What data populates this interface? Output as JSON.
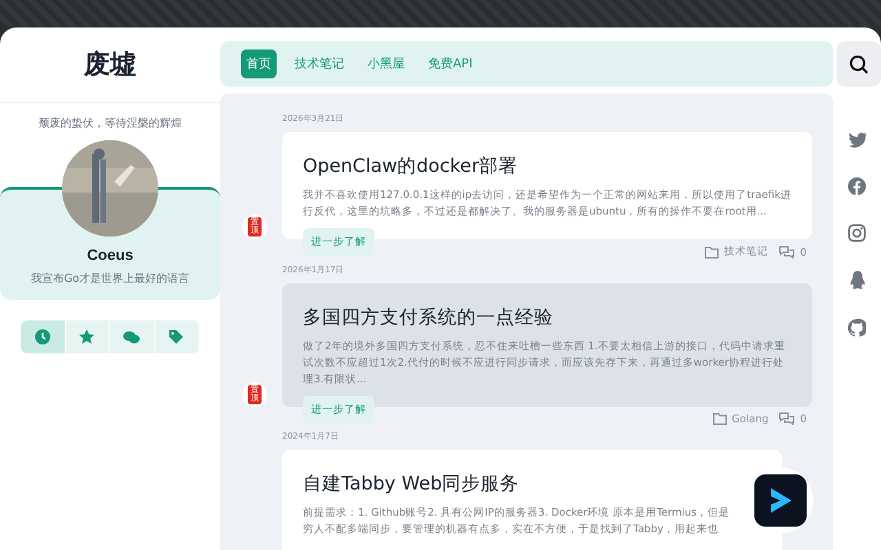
{
  "site": {
    "title": "废墟",
    "motto": "颓废的蛰伏，等待涅槃的辉煌"
  },
  "profile": {
    "name": "Coeus",
    "bio": "我宣布Go才是世界上最好的语言"
  },
  "sidebar_tabs": [
    {
      "kind": "clock",
      "selected": true
    },
    {
      "kind": "star",
      "selected": false
    },
    {
      "kind": "chat",
      "selected": false
    },
    {
      "kind": "tag",
      "selected": false
    }
  ],
  "nav": [
    {
      "label": "首页",
      "selected": true
    },
    {
      "label": "技术笔记",
      "selected": false
    },
    {
      "label": "小黑屋",
      "selected": false
    },
    {
      "label": "免费API",
      "selected": false
    }
  ],
  "social": [
    {
      "kind": "twitter"
    },
    {
      "kind": "facebook"
    },
    {
      "kind": "instagram"
    },
    {
      "kind": "qq"
    },
    {
      "kind": "github"
    }
  ],
  "posts": [
    {
      "date": "2026年3月21日",
      "title": "OpenClaw的docker部署",
      "excerpt": "我并不喜欢使用127.0.0.1这样的ip去访问，还是希望作为一个正常的网站来用，所以使用了traefik进行反代，这里的坑略多，不过还是都解决了。我的服务器是ubuntu，所有的操作不要在root用...",
      "pinned": true,
      "badge": "置顶",
      "hover": false,
      "button": "进一步了解",
      "category": "技术笔记",
      "comments": "0",
      "logo": false
    },
    {
      "date": "2026年1月17日",
      "title": "多国四方支付系统的一点经验",
      "excerpt": "做了2年的境外多国四方支付系统，忍不住来吐槽一些东西 1.不要太相信上游的接口，代码中请求重试次数不应超过1次2.代付的时候不应进行同步请求，而应该先存下来，再通过多worker协程进行处理3.有限状...",
      "pinned": true,
      "badge": "置顶",
      "hover": true,
      "button": "进一步了解",
      "category": "Golang",
      "comments": "0",
      "logo": false
    },
    {
      "date": "2024年1月7日",
      "title": "自建Tabby Web同步服务",
      "excerpt": "前提需求：1. Github账号2. 具有公网IP的服务器3. Docker环境 原本是用Termius，但是穷人不配多端同步，要管理的机器有点多，实在不方便，于是找到了Tabby，用起来也",
      "pinned": false,
      "hover": false,
      "logo": true
    }
  ]
}
